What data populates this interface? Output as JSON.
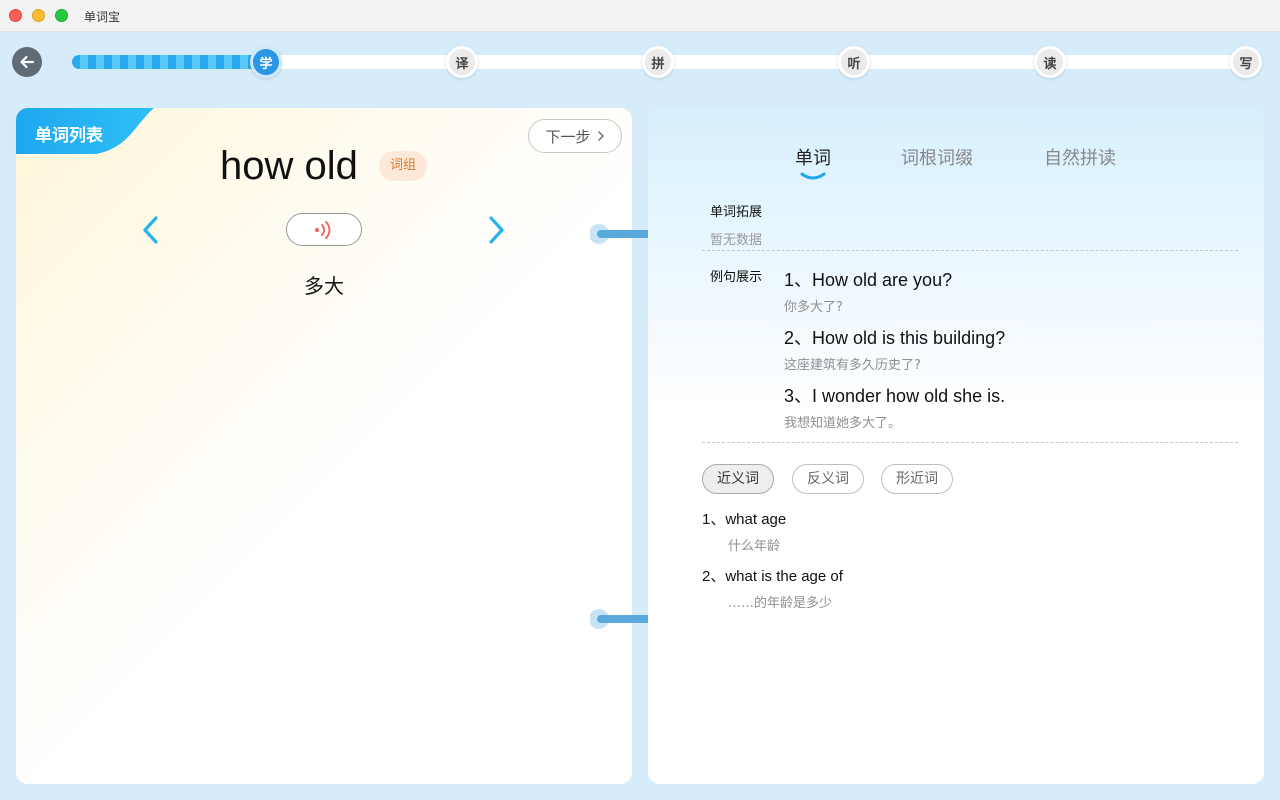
{
  "window": {
    "title": "单词宝"
  },
  "progress": {
    "steps": [
      "学",
      "译",
      "拼",
      "听",
      "读",
      "写"
    ],
    "current_step_index": 0
  },
  "left": {
    "word_list_label": "单词列表",
    "next_label": "下一步",
    "word": "how old",
    "tag": "词组",
    "meaning": "多大"
  },
  "right": {
    "tabs": [
      "单词",
      "词根词缀",
      "自然拼读"
    ],
    "active_tab": "单词",
    "expansion_label": "单词拓展",
    "expansion_empty": "暂无数据",
    "examples_label": "例句展示",
    "examples": [
      {
        "en": "1、How old are you?",
        "zh": "你多大了?"
      },
      {
        "en": "2、How old is this building?",
        "zh": "这座建筑有多久历史了?"
      },
      {
        "en": "3、I wonder how old she is.",
        "zh": "我想知道她多大了。"
      }
    ],
    "relation_tabs": [
      "近义词",
      "反义词",
      "形近词"
    ],
    "active_relation": "近义词",
    "synonyms": [
      {
        "en": "1、what age",
        "zh": "什么年龄"
      },
      {
        "en": "2、what is the age of",
        "zh": "……的年龄是多少"
      }
    ]
  },
  "colors": {
    "accent": "#2b95e6",
    "tab_blue": "#1ea7f0",
    "tag_orange": "#d9792a"
  }
}
